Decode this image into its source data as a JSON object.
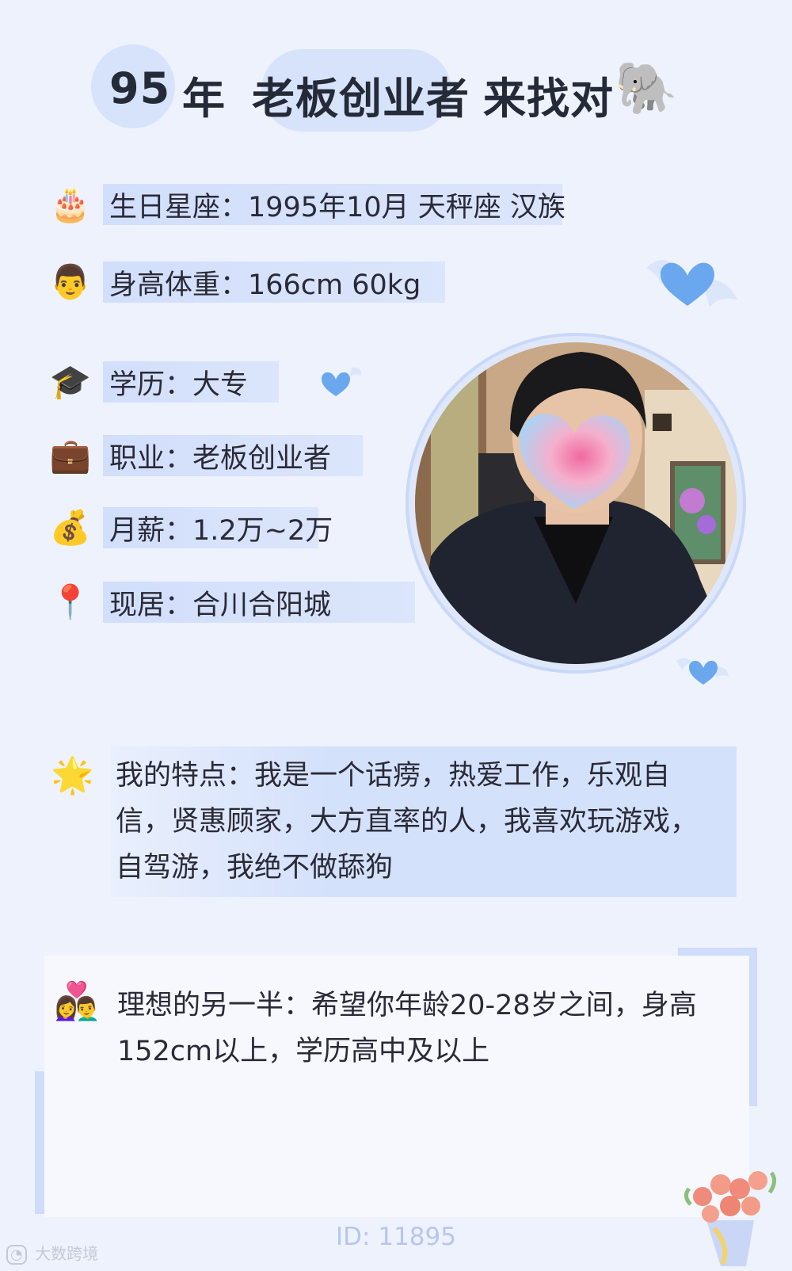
{
  "title": {
    "age": "95",
    "year_suffix": "年",
    "role": "老板创业者",
    "tail": "来找对",
    "emoji": "🐘"
  },
  "info": [
    {
      "icon": "🎂",
      "icon_name": "birthday-cake-icon",
      "text": "生日星座：1995年10月 天秤座 汉族"
    },
    {
      "icon": "👨",
      "icon_name": "man-face-icon",
      "text": "身高体重：166cm 60kg"
    },
    {
      "icon": "🎓",
      "icon_name": "graduation-cap-icon",
      "text": "学历：大专"
    },
    {
      "icon": "💼",
      "icon_name": "briefcase-icon",
      "text": "职业：老板创业者"
    },
    {
      "icon": "💰",
      "icon_name": "money-bag-icon",
      "text": "月薪：1.2万~2万"
    },
    {
      "icon": "📍",
      "icon_name": "location-pin-icon",
      "text": "现居：合川合阳城"
    }
  ],
  "features": {
    "icon": "🌟",
    "text": "我的特点：我是一个话痨，热爱工作，乐观自信，贤惠顾家，大方直率的人，我喜欢玩游戏，自驾游，我绝不做舔狗"
  },
  "ideal": {
    "icon": "👩‍❤️‍👨",
    "text": "理想的另一半：希望你年龄20-28岁之间，身高152cm以上，学历高中及以上"
  },
  "footer": {
    "id": "ID: 11895",
    "watermark": "大数跨境"
  },
  "colors": {
    "background": "#eef2fd",
    "highlight": "#d4e1fb",
    "heart": "#6aa7ef"
  }
}
